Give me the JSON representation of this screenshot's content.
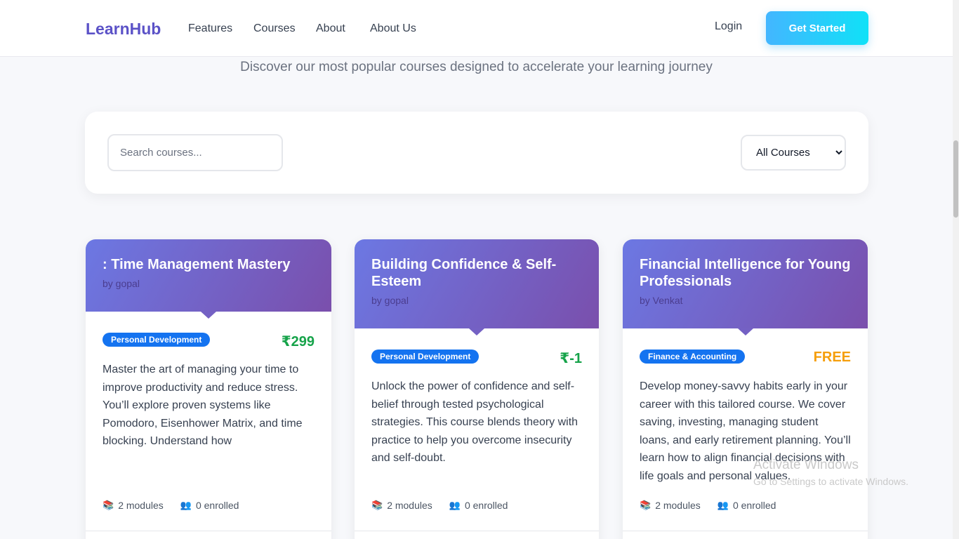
{
  "nav": {
    "brand": "LearnHub",
    "links": [
      "Features",
      "Courses",
      "About",
      "About Us"
    ],
    "login": "Login",
    "cta": "Get Started"
  },
  "hero": {
    "subtitle": "Discover our most popular courses designed to accelerate your learning journey"
  },
  "filters": {
    "search_placeholder": "Search courses...",
    "category_selected": "All Courses"
  },
  "courses": [
    {
      "title": ": Time Management Mastery",
      "author": "by gopal",
      "category": "Personal Development",
      "price": "₹299",
      "price_color": "#16a34a",
      "description": "Master the art of managing your time to improve productivity and reduce stress. You’ll explore proven systems like Pomodoro, Eisenhower Matrix, and time blocking. Understand how",
      "modules": "2 modules",
      "enrolled": "0 enrolled"
    },
    {
      "title": "Building Confidence & Self-Esteem",
      "author": "by gopal",
      "category": "Personal Development",
      "price": "₹-1",
      "price_color": "#16a34a",
      "description": "Unlock the power of confidence and self-belief through tested psychological strategies. This course blends theory with practice to help you overcome insecurity and self-doubt.",
      "modules": "2 modules",
      "enrolled": "0 enrolled"
    },
    {
      "title": "Financial Intelligence for Young Professionals",
      "author": "by Venkat",
      "category": "Finance & Accounting",
      "price": "FREE",
      "price_color": "#f59e0b",
      "description": "Develop money-savvy habits early in your career with this tailored course. We cover saving, investing, managing student loans, and early retirement planning. You’ll learn how to align financial decisions with life goals and personal values.",
      "modules": "2 modules",
      "enrolled": "0 enrolled"
    }
  ],
  "watermark": {
    "line1": "Activate Windows",
    "line2": "Go to Settings to activate Windows."
  },
  "icons": {
    "modules": "books-icon",
    "enrolled": "people-icon"
  }
}
